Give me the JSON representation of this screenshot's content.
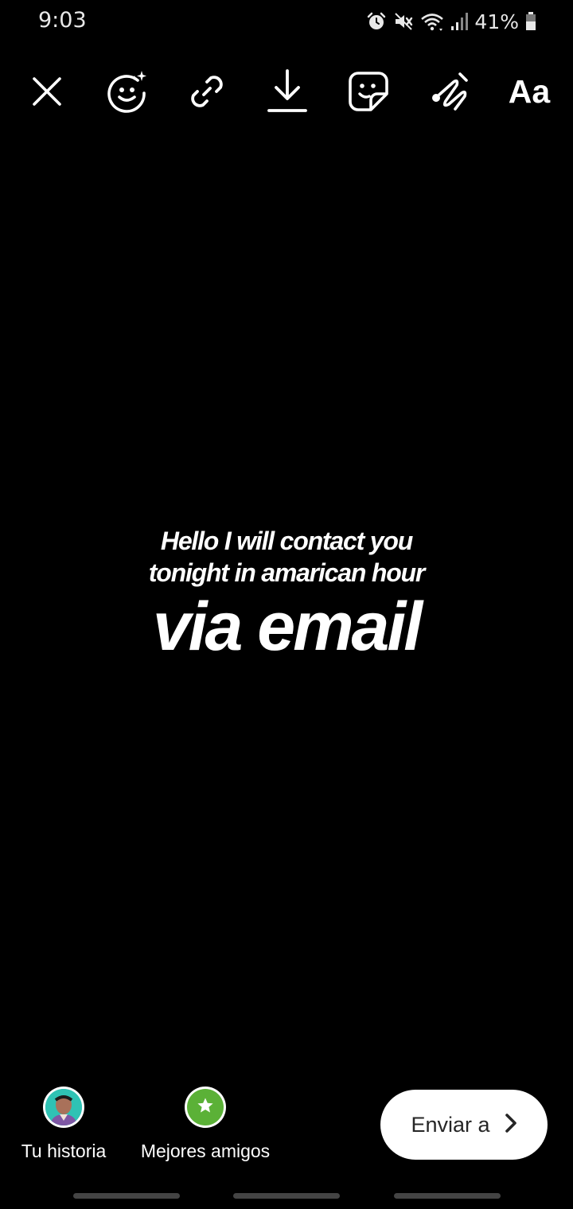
{
  "status_bar": {
    "time": "9:03",
    "battery": "41%",
    "icons": [
      "alarm-icon",
      "mute-icon",
      "wifi-icon",
      "signal-icon",
      "battery-icon"
    ]
  },
  "toolbar": {
    "close_icon": "close-icon",
    "effects_icon": "face-effects-icon",
    "link_icon": "link-icon",
    "download_icon": "download-icon",
    "sticker_icon": "sticker-icon",
    "draw_icon": "draw-icon",
    "text_label": "Aa"
  },
  "story": {
    "line1": "Hello I will contact you",
    "line2": "tonight in amarican hour",
    "line3": "via email",
    "background_color": "#000000",
    "text_color": "#ffffff"
  },
  "bottom": {
    "your_story_label": "Tu historia",
    "close_friends_label": "Mejores amigos",
    "send_label": "Enviar a",
    "close_friends_color": "#5bb137"
  }
}
